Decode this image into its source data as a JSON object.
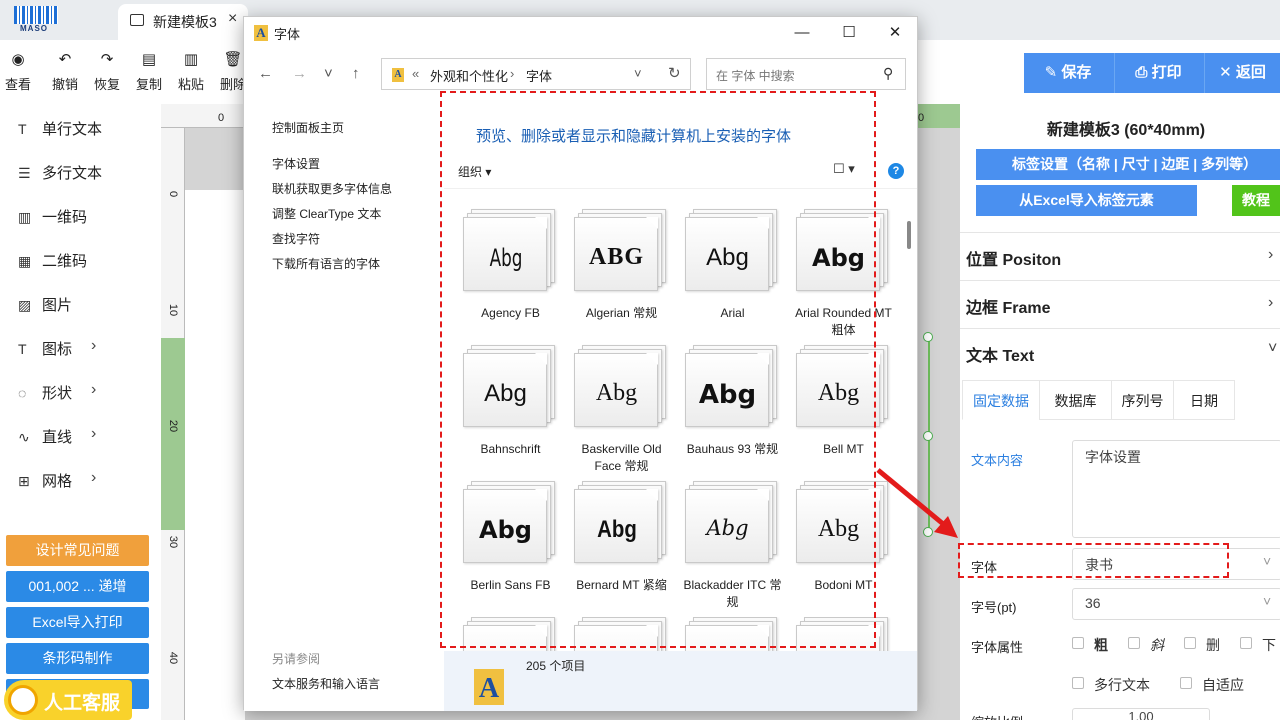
{
  "app": {
    "logo_text": "MASO",
    "tab_title": "新建模板3",
    "tab_close": "×"
  },
  "toolbar": [
    {
      "icon": "◉",
      "label": "查看"
    },
    {
      "icon": "↶",
      "label": "撤销"
    },
    {
      "icon": "↷",
      "label": "恢复"
    },
    {
      "icon": "▤",
      "label": "复制"
    },
    {
      "icon": "▥",
      "label": "粘贴"
    },
    {
      "icon": "🗑",
      "label": "删除"
    }
  ],
  "left_panel": {
    "items": [
      {
        "icon": "T",
        "label": "单行文本"
      },
      {
        "icon": "☰",
        "label": "多行文本"
      },
      {
        "icon": "▥",
        "label": "一维码"
      },
      {
        "icon": "▦",
        "label": "二维码"
      },
      {
        "icon": "▨",
        "label": "图片"
      },
      {
        "icon": "T",
        "label": "图标",
        "arrow": "›"
      },
      {
        "icon": "◌",
        "label": "形状",
        "arrow": "›"
      },
      {
        "icon": "∿",
        "label": "直线",
        "arrow": "›"
      },
      {
        "icon": "⊞",
        "label": "网格",
        "arrow": "›"
      }
    ],
    "buttons": [
      {
        "label": "设计常见问题",
        "color": "#f0a03c"
      },
      {
        "label": "001,002 ... 递增",
        "color": "#2b8ae6"
      },
      {
        "label": "Excel导入打印",
        "color": "#2b8ae6"
      },
      {
        "label": "条形码制作",
        "color": "#2b8ae6"
      }
    ],
    "chat": "人工客服"
  },
  "rulers": {
    "top": [
      "0",
      "0"
    ],
    "left": [
      "0",
      "10",
      "20",
      "30",
      "40"
    ]
  },
  "right_panel": {
    "actions": [
      {
        "icon": "✎",
        "label": "保存"
      },
      {
        "icon": "⎙",
        "label": "打印"
      },
      {
        "icon": "✕",
        "label": "返回"
      }
    ],
    "template_title": "新建模板3 (60*40mm)",
    "label_settings": "标签设置（名称 | 尺寸 | 边距 | 多列等）",
    "excel_import": "从Excel导入标签元素",
    "tutorial": "教程",
    "sections": [
      {
        "label": "位置 Positon",
        "arrow": "›"
      },
      {
        "label": "边框 Frame",
        "arrow": "›"
      },
      {
        "label": "文本 Text",
        "arrow": "˅"
      }
    ],
    "text_tabs": [
      "固定数据",
      "数据库",
      "序列号",
      "日期"
    ],
    "text_content_label": "文本内容",
    "text_content_value": "字体设置",
    "font_label": "字体",
    "font_value": "隶书",
    "size_label": "字号(pt)",
    "size_value": "36",
    "attr_label": "字体属性",
    "attrs": [
      "粗",
      "斜",
      "删",
      "下"
    ],
    "multiline": "多行文本",
    "autofit": "自适应",
    "scale_label": "缩放比例",
    "scale_value": "1.00"
  },
  "dialog": {
    "title": "字体",
    "window_controls": [
      "—",
      "☐",
      "✕"
    ],
    "nav": [
      "←",
      "→",
      "˅",
      "↑"
    ],
    "breadcrumb": [
      "«",
      "外观和个性化",
      "›",
      "字体"
    ],
    "address_dropdown": "˅",
    "refresh": "↻",
    "search_placeholder": "在 字体 中搜索",
    "left_links": [
      "控制面板主页",
      "字体设置",
      "联机获取更多字体信息",
      "调整 ClearType 文本",
      "查找字符",
      "下载所有语言的字体"
    ],
    "see_also_title": "另请参阅",
    "see_also_link": "文本服务和输入语言",
    "heading": "预览、删除或者显示和隐藏计算机上安装的字体",
    "organize": "组织 ▾",
    "view_icon": "☐ ▾",
    "help_icon": "?",
    "fonts": [
      {
        "name": "Agency FB",
        "sample": "Abg",
        "style": "condensed"
      },
      {
        "name": "Algerian 常规",
        "sample": "ABG",
        "style": "decor"
      },
      {
        "name": "Arial",
        "sample": "Abg",
        "style": "sans"
      },
      {
        "name": "Arial Rounded MT 粗体",
        "sample": "Abg",
        "style": "bold"
      },
      {
        "name": "Bahnschrift",
        "sample": "Abg",
        "style": "sans"
      },
      {
        "name": "Baskerville Old Face 常规",
        "sample": "Abg",
        "style": "serif"
      },
      {
        "name": "Bauhaus 93 常规",
        "sample": "Abg",
        "style": "heavy"
      },
      {
        "name": "Bell MT",
        "sample": "Abg",
        "style": "serif"
      },
      {
        "name": "Berlin Sans FB",
        "sample": "Abg",
        "style": "bold"
      },
      {
        "name": "Bernard MT 紧缩",
        "sample": "Abg",
        "style": "condensedbold"
      },
      {
        "name": "Blackadder ITC 常规",
        "sample": "Abg",
        "style": "script"
      },
      {
        "name": "Bodoni MT",
        "sample": "Abg",
        "style": "serif"
      }
    ],
    "status": "205 个项目"
  }
}
